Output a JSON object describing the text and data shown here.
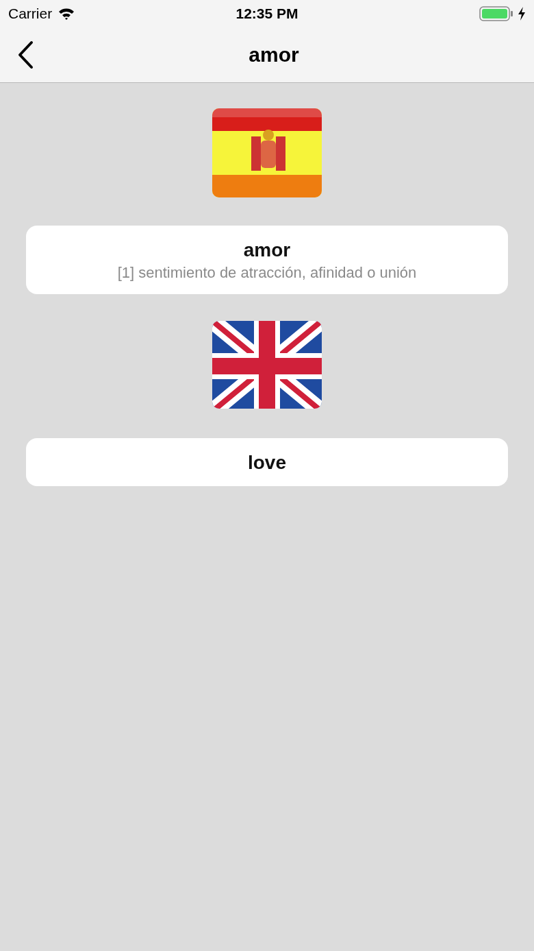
{
  "status_bar": {
    "carrier": "Carrier",
    "time": "12:35 PM"
  },
  "nav_bar": {
    "title": "amor"
  },
  "entries": [
    {
      "flag": {
        "kind": "spain"
      },
      "word": "amor",
      "definition": "[1] sentimiento de atracción, afinidad o unión"
    },
    {
      "flag": {
        "kind": "uk"
      },
      "word": "love"
    }
  ]
}
